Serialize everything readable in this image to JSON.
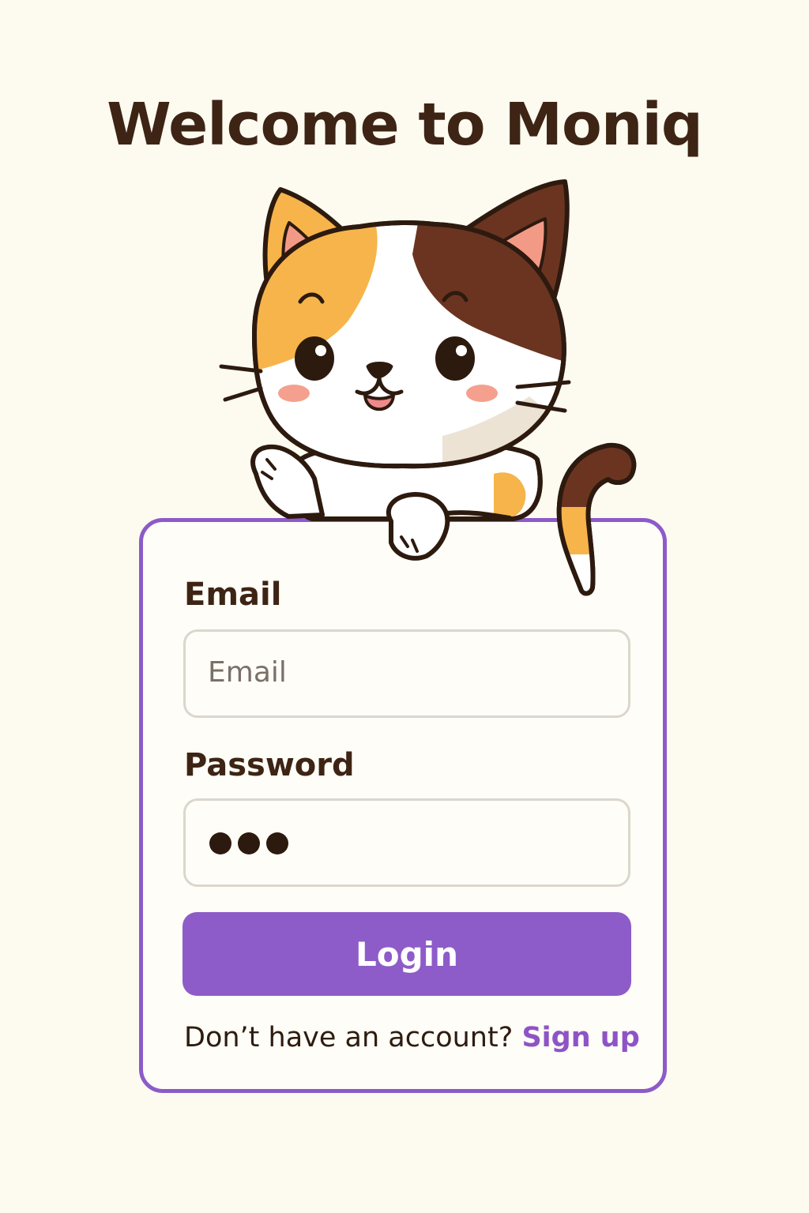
{
  "header": {
    "title": "Welcome to Moniq"
  },
  "mascot": {
    "icon": "calico-cat-mascot-icon"
  },
  "login_form": {
    "email_label": "Email",
    "email_placeholder": "Email",
    "email_value": "",
    "password_label": "Password",
    "password_dot_count": 3,
    "login_button_label": "Login",
    "signup_prompt": "Don’t have an account?",
    "signup_link_label": "Sign up"
  },
  "colors": {
    "background": "#fdfbf0",
    "accent": "#8e5cc9",
    "text": "#3d2414",
    "cat_orange": "#f6b44a",
    "cat_brown": "#6b3421"
  }
}
